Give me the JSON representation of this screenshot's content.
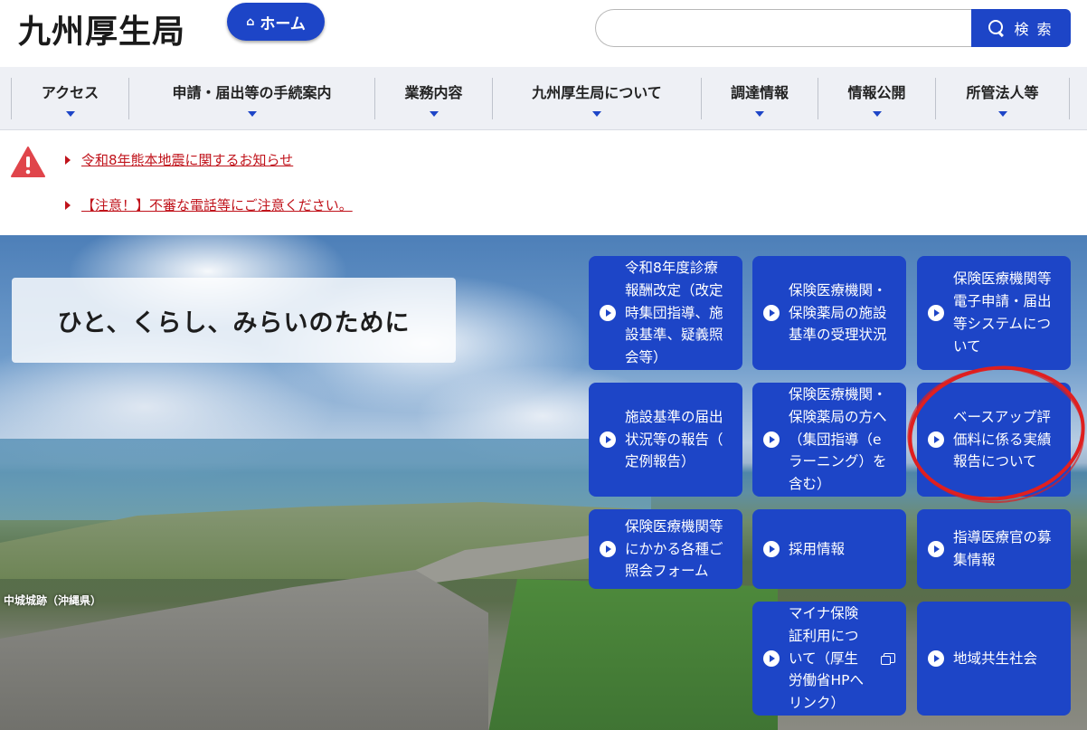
{
  "header": {
    "site_title": "九州厚生局",
    "home_label": "ホーム",
    "search_placeholder": "",
    "search_button": "検 索"
  },
  "nav": {
    "items": [
      {
        "label": "アクセス"
      },
      {
        "label": "申請・届出等の手続案内"
      },
      {
        "label": "業務内容"
      },
      {
        "label": "九州厚生局について"
      },
      {
        "label": "調達情報"
      },
      {
        "label": "情報公開"
      },
      {
        "label": "所管法人等"
      }
    ]
  },
  "alerts": [
    {
      "text": "令和8年熊本地震に関するお知らせ"
    },
    {
      "text": "【注意！】不審な電話等にご注意ください。"
    }
  ],
  "hero": {
    "tagline": "ひと、くらし、みらいのために",
    "caption": "中城城跡（沖縄県）"
  },
  "tiles": [
    {
      "lines": [
        "令和8年度診療",
        "報酬改定（改定",
        "時集団指導、施",
        "設基準、疑義照",
        "会等）"
      ]
    },
    {
      "lines": [
        "保険医療機関・",
        "保険薬局の施設",
        "基準の受理状況"
      ]
    },
    {
      "lines": [
        "保険医療機関等",
        "電子申請・届出",
        "等システムにつ",
        "いて"
      ]
    },
    {
      "lines": [
        "施設基準の届出",
        "状況等の報告（",
        "定例報告）"
      ]
    },
    {
      "lines": [
        "保険医療機関・",
        "保険薬局の方へ",
        "（集団指導（e",
        "ラーニング）を",
        "含む）"
      ]
    },
    {
      "lines": [
        "ベースアップ評",
        "価料に係る実績",
        "報告について"
      ]
    },
    {
      "lines": [
        "保険医療機関等",
        "にかかる各種ご",
        "照会フォーム"
      ]
    },
    {
      "lines": [
        "採用情報"
      ]
    },
    {
      "lines": [
        "指導医療官の募",
        "集情報"
      ]
    },
    {
      "lines": [
        "マイナ保険",
        "証利用につ",
        "いて（厚生",
        "労働省HPへ",
        "リンク）"
      ]
    },
    {
      "lines": [
        "地域共生社会"
      ]
    }
  ],
  "colors": {
    "brand_blue": "#1d45c7",
    "alert_red": "#c0131b",
    "nav_bg": "#eef0f5"
  }
}
